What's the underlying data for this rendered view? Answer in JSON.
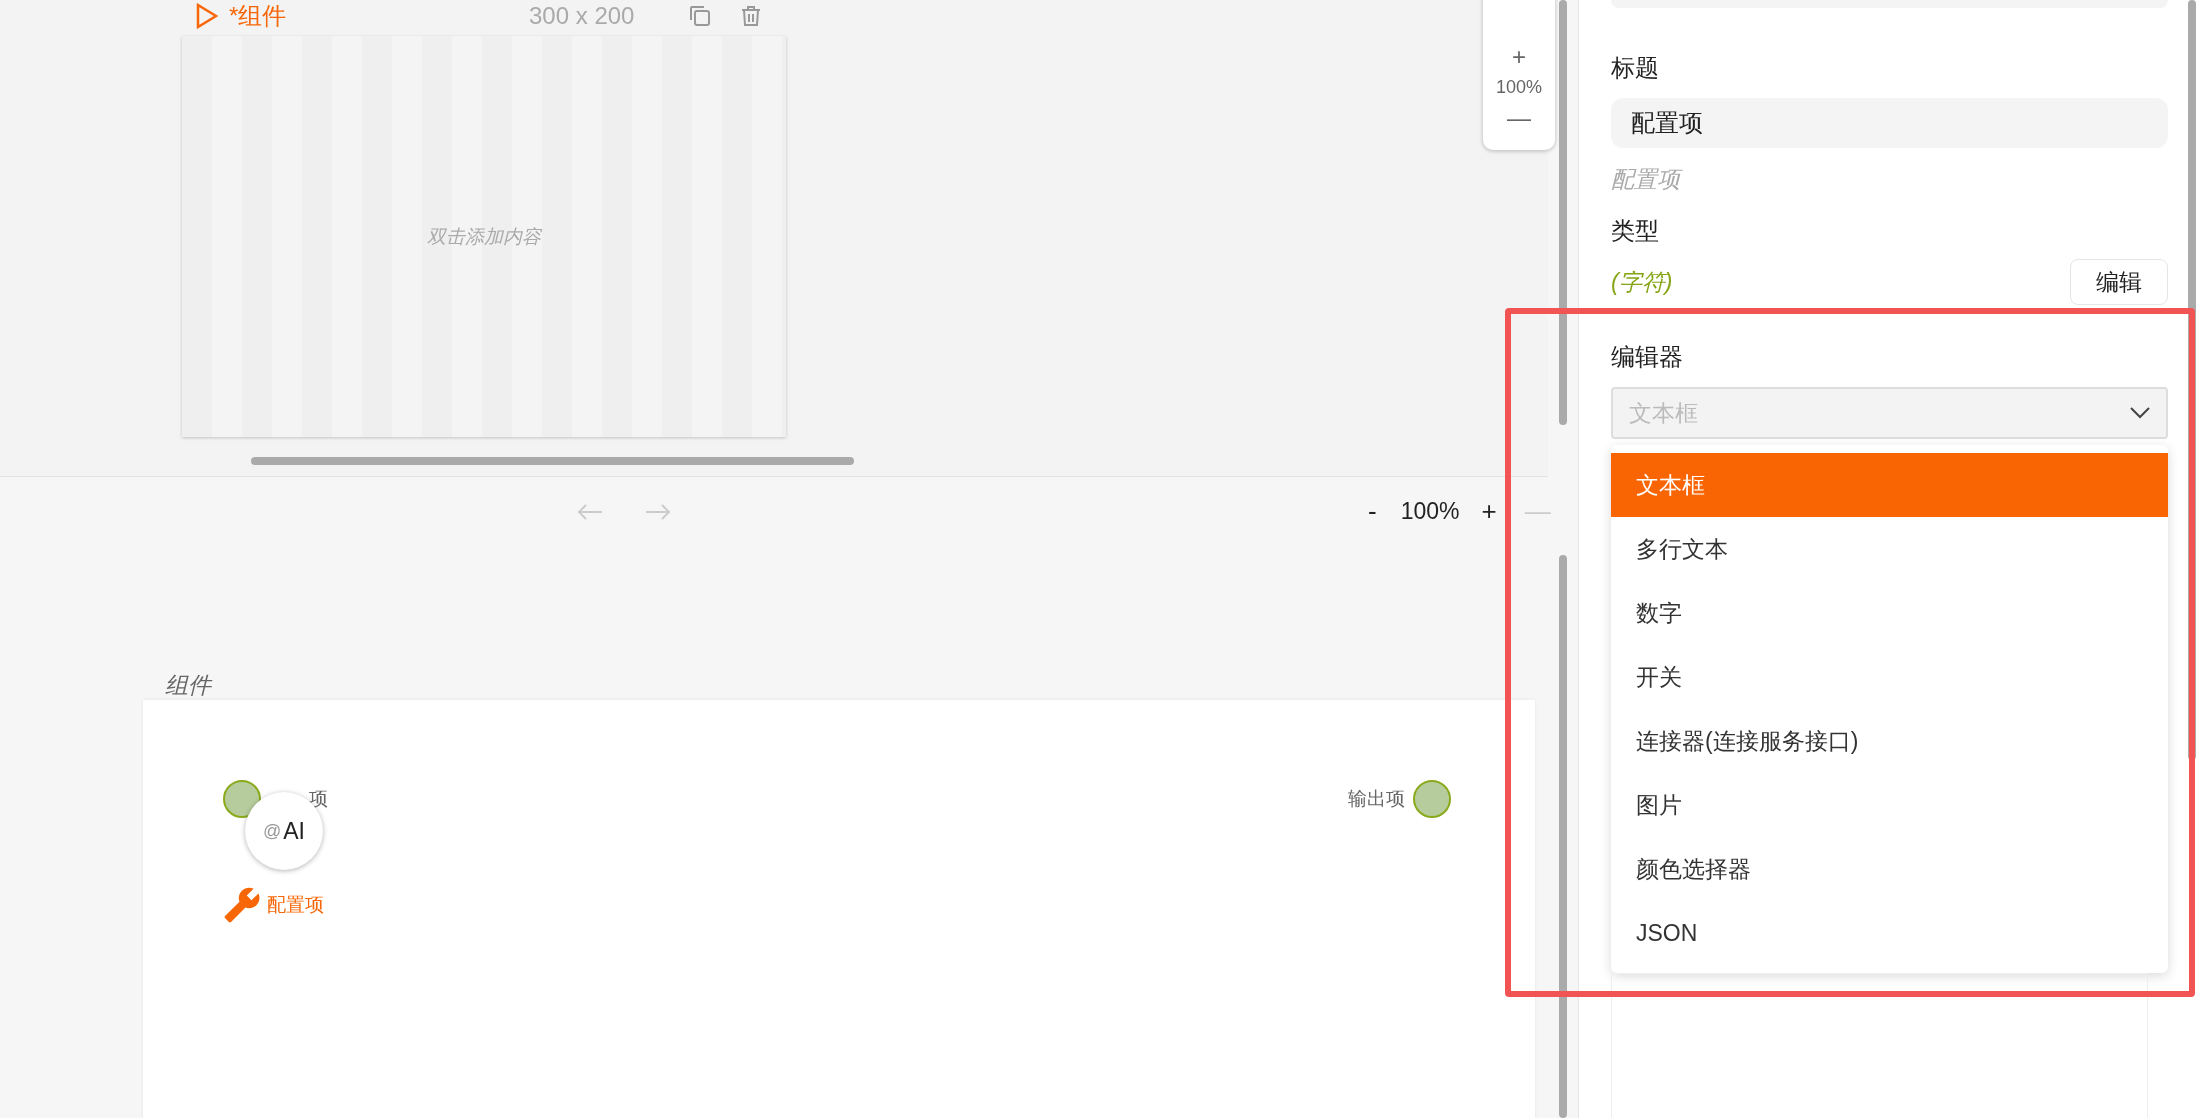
{
  "preview": {
    "title": "*组件",
    "size": "300 x 200",
    "placeholder": "双击添加内容"
  },
  "zoom_control": {
    "plus": "+",
    "zoom": "100%",
    "minus": "—"
  },
  "toolbar": {
    "zoom_out": "-",
    "zoom": "100%",
    "zoom_in": "+",
    "collapse": "—"
  },
  "diagram": {
    "title": "组件",
    "input_label": "项",
    "output_label": "输出项",
    "ai_badge": {
      "prefix": "@",
      "label": "AI"
    },
    "config_link": "配置项"
  },
  "panel": {
    "title_label": "标题",
    "title_value": "配置项",
    "title_hint": "配置项",
    "type_label": "类型",
    "type_value": "(字符)",
    "edit_button": "编辑",
    "editor_label": "编辑器",
    "editor_select": {
      "placeholder": "文本框",
      "expanded": true
    },
    "options": [
      {
        "label": "文本框",
        "selected": true
      },
      {
        "label": "多行文本",
        "selected": false
      },
      {
        "label": "数字",
        "selected": false
      },
      {
        "label": "开关",
        "selected": false
      },
      {
        "label": "连接器(连接服务接口)",
        "selected": false
      },
      {
        "label": "图片",
        "selected": false
      },
      {
        "label": "颜色选择器",
        "selected": false
      },
      {
        "label": "JSON",
        "selected": false
      }
    ]
  }
}
